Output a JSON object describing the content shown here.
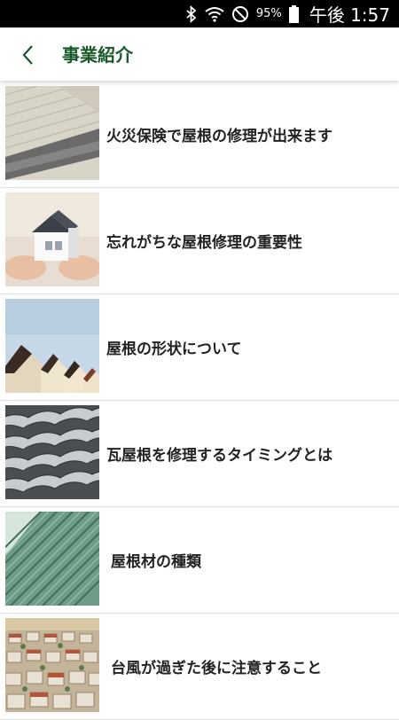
{
  "status_bar": {
    "battery_percent": "95%",
    "time": "午後 1:57",
    "icons": [
      "bluetooth-icon",
      "wifi-icon",
      "do-not-disturb-icon",
      "battery-icon"
    ]
  },
  "header": {
    "back_icon": "chevron-left-icon",
    "title": "事業紹介"
  },
  "list": {
    "items": [
      {
        "label": "火災保険で屋根の修理が出来ます",
        "image": "roof-siding-image"
      },
      {
        "label": "忘れがちな屋根修理の重要性",
        "image": "house-in-hands-image"
      },
      {
        "label": "屋根の形状について",
        "image": "rooftops-row-image"
      },
      {
        "label": "瓦屋根を修理するタイミングとは",
        "image": "roof-tiles-image"
      },
      {
        "label": "屋根材の種類",
        "image": "metal-roof-panels-image"
      },
      {
        "label": "台風が過ぎた後に注意すること",
        "image": "aerial-houses-image"
      }
    ]
  },
  "colors": {
    "title_green": "#1a5a2a",
    "status_bar_bg": "#000000"
  }
}
